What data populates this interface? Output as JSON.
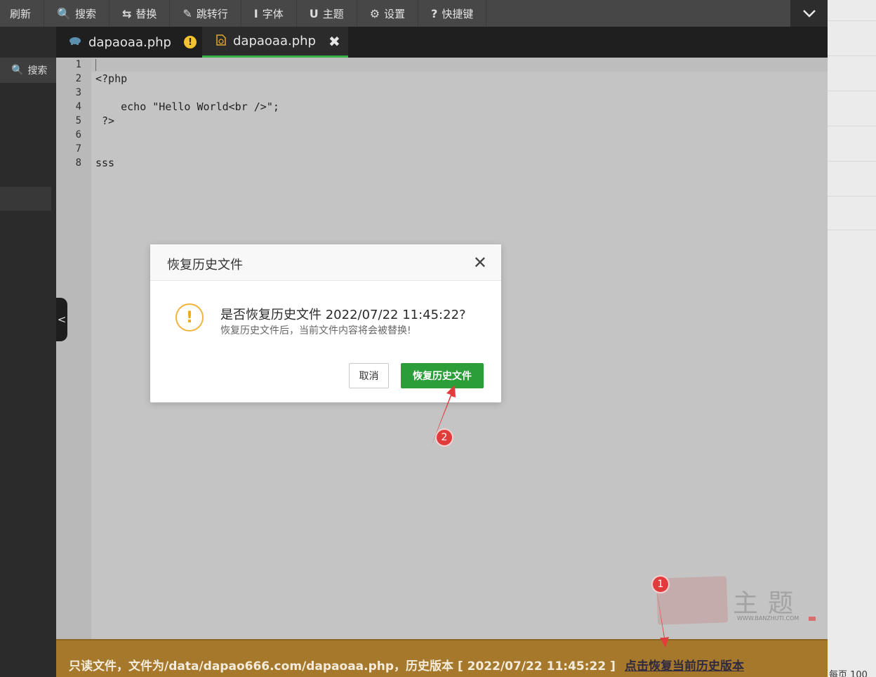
{
  "toolbar": {
    "buttons": [
      {
        "icon": "refresh-icon",
        "glyph": "",
        "label": "刷新"
      },
      {
        "icon": "search-icon",
        "glyph": "🔍",
        "label": "搜索"
      },
      {
        "icon": "replace-icon",
        "glyph": "⇆",
        "label": "替换"
      },
      {
        "icon": "pin-icon",
        "glyph": "✎",
        "label": "跳转行"
      },
      {
        "icon": "font-icon",
        "glyph": "I",
        "label": "字体"
      },
      {
        "icon": "theme-icon",
        "glyph": "U",
        "label": "主题"
      },
      {
        "icon": "gear-icon",
        "glyph": "⚙",
        "label": "设置"
      },
      {
        "icon": "help-icon",
        "glyph": "?",
        "label": "快捷键"
      }
    ],
    "toggle_icon": "chevron-down-icon"
  },
  "sidebar": {
    "search_label": "搜索"
  },
  "tabs": [
    {
      "label": "dapaoaa.php",
      "icon": "php-elephant-icon",
      "status_icon": "warning-icon",
      "status_glyph": "!"
    },
    {
      "label": "dapaoaa.php",
      "icon": "history-file-icon",
      "status_icon": "close-icon",
      "status_glyph": "✖"
    }
  ],
  "editor": {
    "line_numbers": [
      "1",
      "2",
      "3",
      "4",
      "5",
      "6",
      "7",
      "8"
    ],
    "lines": [
      "",
      "<?php",
      "",
      "    echo \"Hello World<br />\";",
      " ?>",
      "",
      "",
      "sss"
    ],
    "collapse_glyph": "<"
  },
  "dialog": {
    "title": "恢复历史文件",
    "close_glyph": "✕",
    "warn_glyph": "!",
    "message": "是否恢复历史文件 2022/07/22 11:45:22?",
    "sub_message": "恢复历史文件后，当前文件内容将会被替换!",
    "cancel_label": "取消",
    "confirm_label": "恢复历史文件"
  },
  "statusbar": {
    "text": "只读文件，文件为/data/dapao666.com/dapaoaa.php，历史版本 [ 2022/07/22 11:45:22 ]",
    "link": "点击恢复当前历史版本"
  },
  "annotations": {
    "marker_1": "1",
    "marker_2": "2",
    "arrow_color": "#e23b3b"
  },
  "watermark": {
    "text": "主题",
    "sub": "WWW.BANZHUTI.COM"
  },
  "right_strip": {
    "footer": "每页 100"
  },
  "colors": {
    "accent_green": "#2b9e3a",
    "status_bg": "#a5782b",
    "warn": "#f0b43c"
  }
}
